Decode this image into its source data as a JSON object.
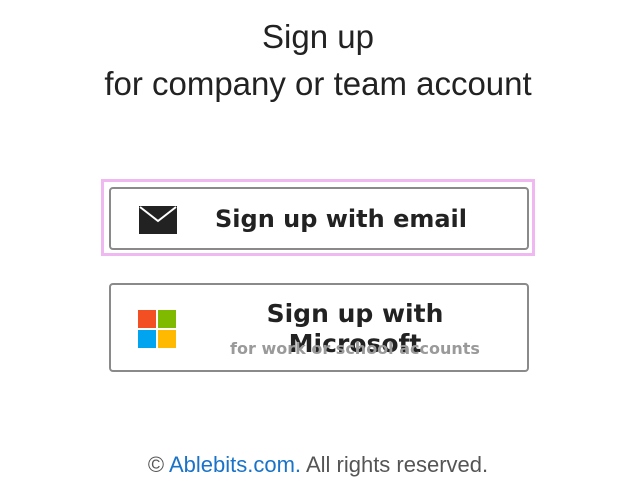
{
  "header": {
    "title": "Sign up",
    "subtitle": "for company or team account"
  },
  "email_button": {
    "label": "Sign up with email",
    "icon": "envelope-icon"
  },
  "microsoft_button": {
    "label": "Sign up with Microsoft",
    "sublabel": "for work or school accounts",
    "icon": "microsoft-logo-icon"
  },
  "footer": {
    "copyright_symbol": "©",
    "link_text": "Ablebits.com.",
    "rights_text": "All rights reserved."
  },
  "colors": {
    "focus_ring": "#f0b8f0",
    "link": "#1a73c8",
    "ms_red": "#f25022",
    "ms_green": "#7fba00",
    "ms_blue": "#00a4ef",
    "ms_yellow": "#ffb900"
  }
}
